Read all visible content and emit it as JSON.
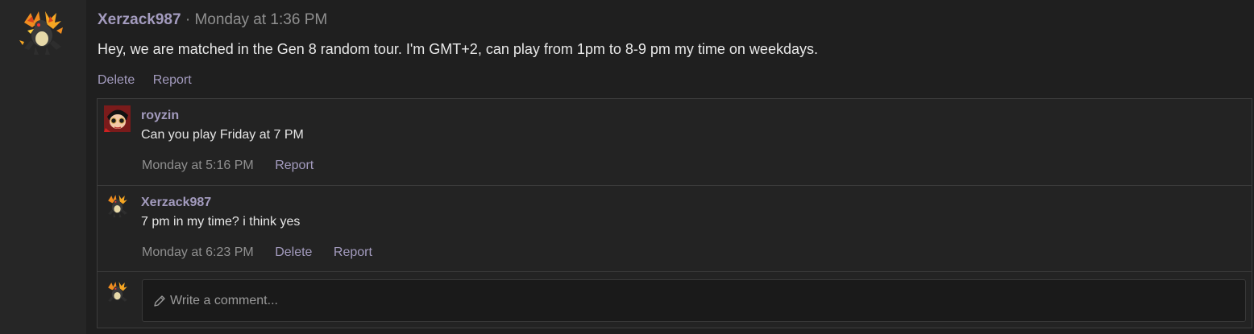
{
  "post": {
    "author": "Xerzack987",
    "separator": "·",
    "time": "Monday at 1:36 PM",
    "body": "Hey, we are matched in the Gen 8 random tour. I'm GMT+2, can play from 1pm to 8-9 pm my time on weekdays.",
    "actions": {
      "delete": "Delete",
      "report": "Report"
    },
    "avatar_icon": "charizard-sprite-icon"
  },
  "comments": [
    {
      "author": "royzin",
      "text": "Can you play Friday at 7 PM",
      "time": "Monday at 5:16 PM",
      "report": "Report",
      "avatar_icon": "anime-avatar-icon"
    },
    {
      "author": "Xerzack987",
      "text": "7 pm in my time? i think yes",
      "time": "Monday at 6:23 PM",
      "delete": "Delete",
      "report": "Report",
      "avatar_icon": "charizard-sprite-icon"
    }
  ],
  "composer": {
    "placeholder": "Write a comment...",
    "icon": "pencil-icon"
  },
  "colors": {
    "background": "#1f1f1f",
    "rail": "#262626",
    "accent_link": "#a39bbe",
    "muted": "#8f8f8f"
  }
}
